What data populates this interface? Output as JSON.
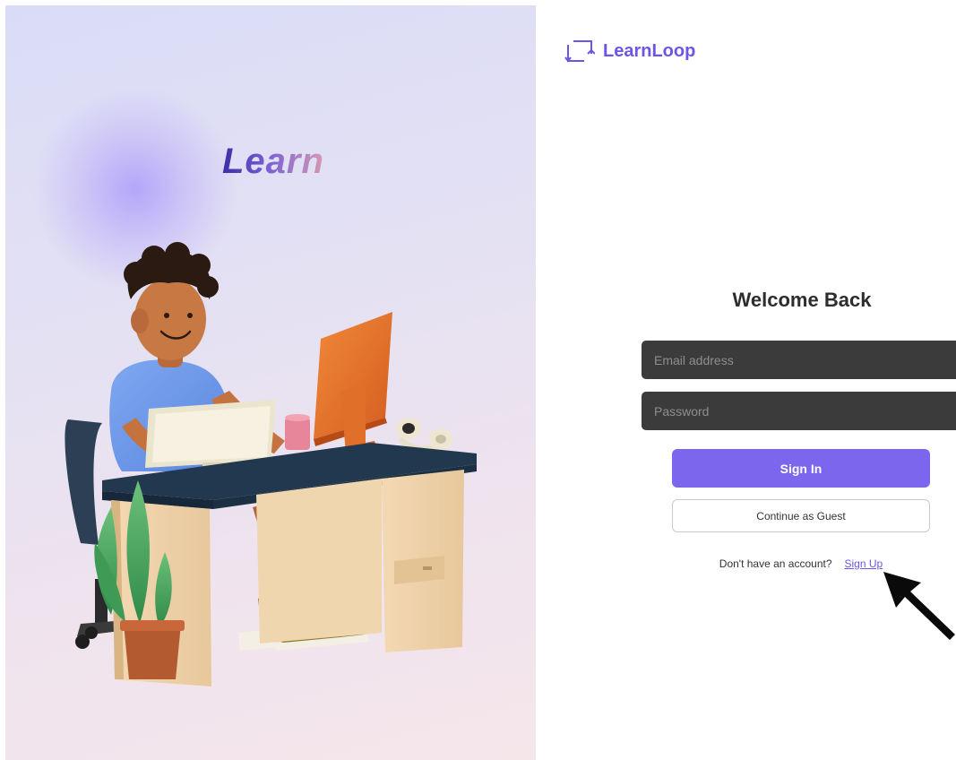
{
  "brand": {
    "name": "LearnLoop",
    "icon": "loop-arrows-icon",
    "accent_color": "#6e55e8"
  },
  "hero": {
    "word": "Learn",
    "illustration": "person-at-desk-illustration"
  },
  "form": {
    "title": "Welcome Back",
    "email_placeholder": "Email address",
    "password_placeholder": "Password",
    "sign_in_label": "Sign In",
    "guest_label": "Continue as Guest",
    "signup_prompt": "Don't have an account?",
    "signup_link": "Sign Up",
    "primary_color": "#7c66ee"
  },
  "annotation": {
    "icon": "pointer-arrow-icon"
  }
}
